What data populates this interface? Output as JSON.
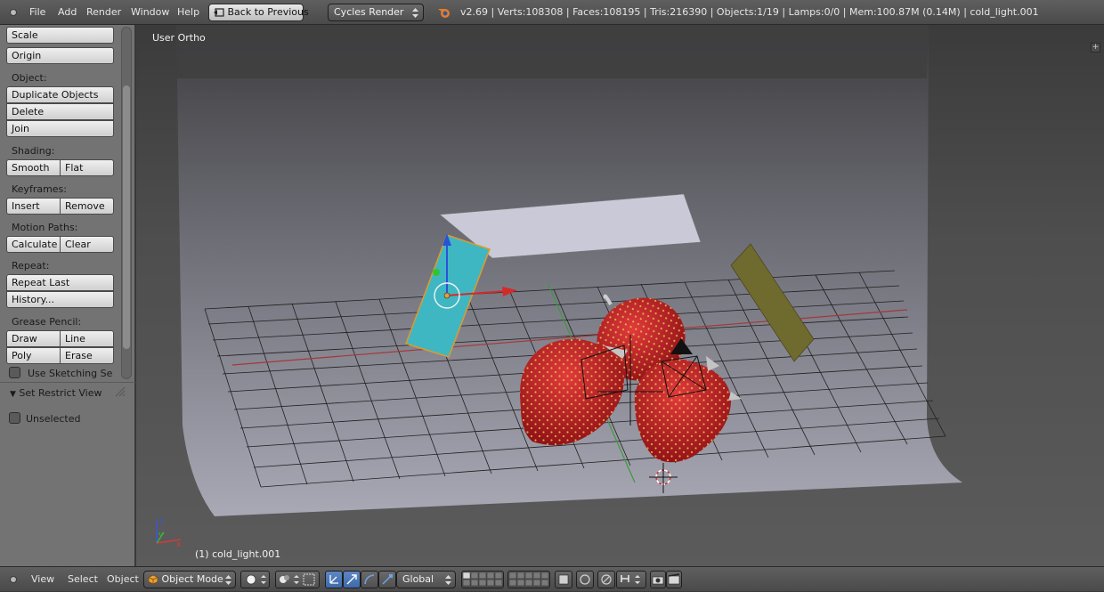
{
  "menubar": {
    "items": [
      "File",
      "Add",
      "Render",
      "Window",
      "Help"
    ],
    "back_button": "Back to Previous",
    "render_engine": "Cycles Render",
    "stats": "v2.69 | Verts:108308 | Faces:108195 | Tris:216390 | Objects:1/19 | Lamps:0/0 | Mem:100.87M (0.14M) | cold_light.001"
  },
  "toolshelf": {
    "scale": "Scale",
    "origin": "Origin",
    "object_header": "Object:",
    "duplicate": "Duplicate Objects",
    "delete": "Delete",
    "join": "Join",
    "shading_header": "Shading:",
    "smooth": "Smooth",
    "flat": "Flat",
    "keyframes_header": "Keyframes:",
    "insert": "Insert",
    "remove": "Remove",
    "motion_header": "Motion Paths:",
    "calculate": "Calculate",
    "clear": "Clear",
    "repeat_header": "Repeat:",
    "repeat_last": "Repeat Last",
    "history": "History...",
    "grease_header": "Grease Pencil:",
    "draw": "Draw",
    "line": "Line",
    "poly": "Poly",
    "erase": "Erase",
    "sketching": "Use Sketching Sessi",
    "restrict_panel": "Set Restrict View",
    "unselected": "Unselected"
  },
  "viewport": {
    "view_name": "User Ortho",
    "active_object": "(1) cold_light.001"
  },
  "footer": {
    "menu": [
      "View",
      "Select",
      "Object"
    ],
    "mode": "Object Mode",
    "orientation": "Global"
  },
  "colors": {
    "selected_plane": "#3fb7c3",
    "key_light": "#6f6a2e",
    "strawberry": "#c8202a",
    "active_button": "#4a78bb"
  }
}
